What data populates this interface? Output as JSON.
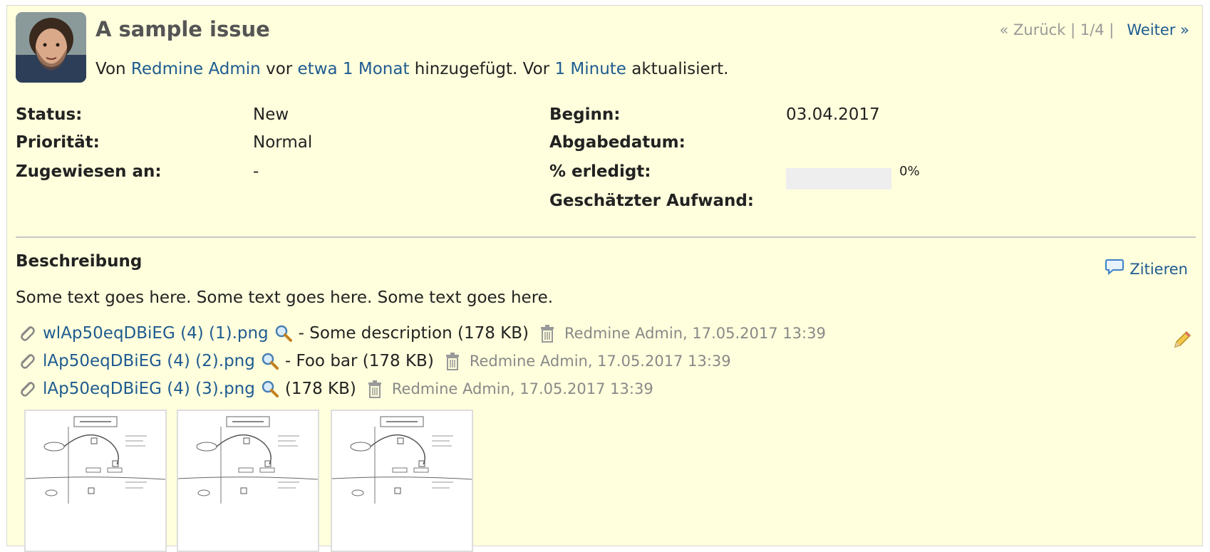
{
  "issue": {
    "title": "A sample issue",
    "byline": {
      "prefix": "Von ",
      "author": "Redmine Admin",
      "mid1": " vor ",
      "created_ago": "etwa 1 Monat",
      "mid2": " hinzugefügt. Vor ",
      "updated_ago": "1 Minute",
      "suffix": " aktualisiert."
    }
  },
  "pager": {
    "prev": "« Zurück",
    "sep": " | ",
    "position": "1/4",
    "sep2": " |",
    "next": "Weiter »"
  },
  "attributes": {
    "status_label": "Status:",
    "status_value": "New",
    "priority_label": "Priorität:",
    "priority_value": "Normal",
    "assignee_label": "Zugewiesen an:",
    "assignee_value": "-",
    "start_label": "Beginn:",
    "start_value": "03.04.2017",
    "due_label": "Abgabedatum:",
    "due_value": "",
    "done_label": "% erledigt:",
    "done_value": "0%",
    "done_fraction": 0,
    "estimated_label": "Geschätzter Aufwand:",
    "estimated_value": ""
  },
  "description": {
    "title": "Beschreibung",
    "quote_label": "Zitieren",
    "text": "Some text goes here. Some text goes here. Some text goes here."
  },
  "attachments": [
    {
      "filename": "wlAp50eqDBiEG (4) (1).png",
      "description": " - Some description (178 KB)",
      "meta": "Redmine Admin, 17.05.2017 13:39"
    },
    {
      "filename": "lAp50eqDBiEG (4) (2).png",
      "description": " - Foo bar (178 KB)",
      "meta": "Redmine Admin, 17.05.2017 13:39"
    },
    {
      "filename": "lAp50eqDBiEG (4) (3).png",
      "description": " (178 KB)",
      "meta": "Redmine Admin, 17.05.2017 13:39"
    }
  ],
  "icons": {
    "avatar": "avatar-photo",
    "quote": "speech-bubble-icon",
    "attachment": "paperclip-icon",
    "preview": "magnifier-icon",
    "delete": "trash-icon",
    "edit": "pencil-icon"
  },
  "colors": {
    "issue_background": "#ffffdd",
    "link": "#1e5b91",
    "muted": "#888888"
  }
}
